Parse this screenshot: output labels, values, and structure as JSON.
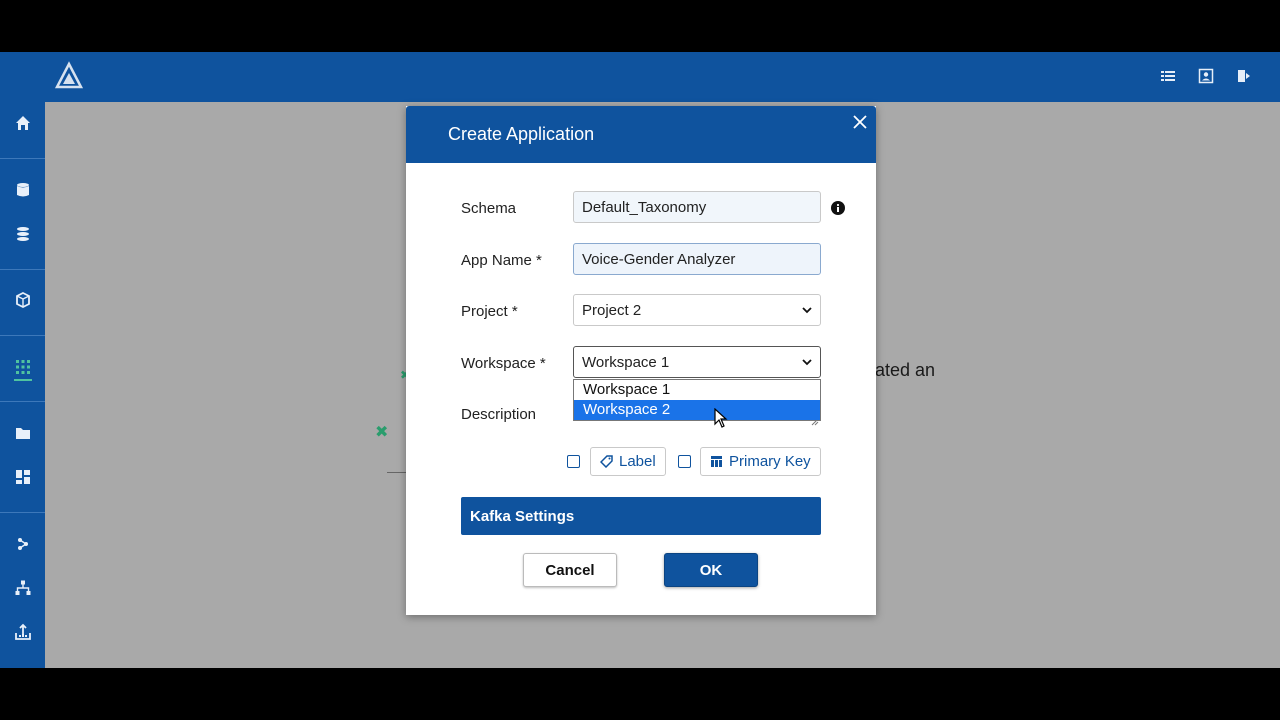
{
  "app": {
    "accent_color": "#0f539e",
    "topbar_icons": [
      "list-icon",
      "user-profile-icon",
      "logout-icon"
    ],
    "sidebar_icons": [
      "home-icon",
      "database-icon",
      "stack-icon",
      "cube-icon",
      "grid-icon",
      "folder-icon",
      "dashboard-icon",
      "flow-icon",
      "network-icon",
      "export-icon"
    ]
  },
  "background": {
    "partial_text": "ated an"
  },
  "dialog": {
    "title": "Create Application",
    "schema": {
      "label": "Schema",
      "value": "Default_Taxonomy"
    },
    "app_name": {
      "label": "App Name *",
      "value": "Voice-Gender Analyzer"
    },
    "project": {
      "label": "Project *",
      "value": "Project 2"
    },
    "workspace": {
      "label": "Workspace *",
      "value": "Workspace 1",
      "options": [
        "Workspace 1",
        "Workspace 2"
      ],
      "highlighted": "Workspace 2"
    },
    "description": {
      "label": "Description"
    },
    "label_chip": "Label",
    "primary_key_chip": "Primary Key",
    "kafka_settings": "Kafka Settings",
    "cancel": "Cancel",
    "ok": "OK"
  }
}
